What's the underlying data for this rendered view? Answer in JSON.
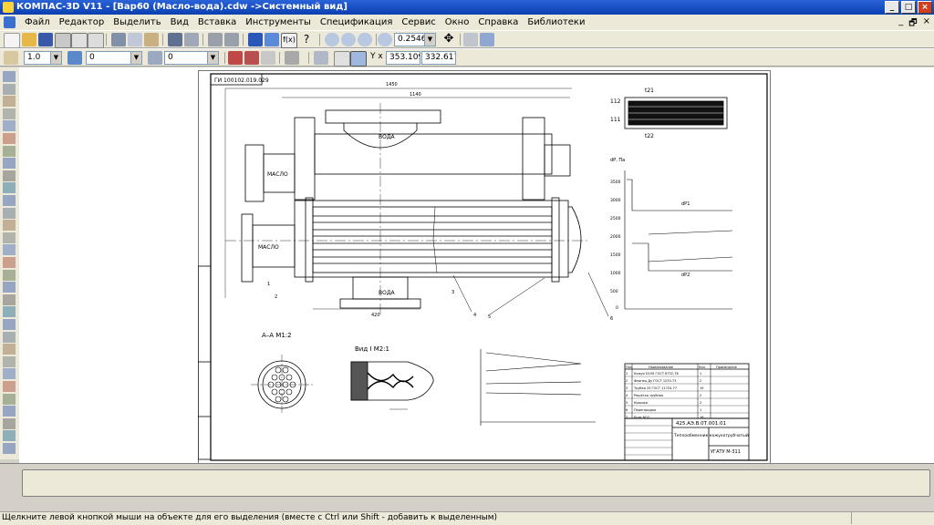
{
  "window": {
    "title": "КОМПАС-3D V11 - [Вар60 (Масло-вода).cdw ->Системный вид]",
    "minimize_glyph": "_",
    "maximize_glyph": "□",
    "close_glyph": "×",
    "doc_min_glyph": "_",
    "doc_restore_glyph": "🗗",
    "doc_close_glyph": "×"
  },
  "menu": [
    "Файл",
    "Редактор",
    "Выделить",
    "Вид",
    "Вставка",
    "Инструменты",
    "Спецификация",
    "Сервис",
    "Окно",
    "Справка",
    "Библиотеки"
  ],
  "toolbar": {
    "zoom_value": "0.2546",
    "step_value": "1.0",
    "layer_value": "0",
    "style_value": "0",
    "coord_x": "353.109",
    "coord_y": "332.617",
    "coord_label": "Y x"
  },
  "drawing": {
    "stamp_top": "ГИ 100102.019.029",
    "section_label": "А–А  М1:2",
    "view_label": "Вид  I   М2:1",
    "label_maslo_in": "МАСЛО",
    "label_maslo_out": "МАСЛО",
    "label_voda_top": "ВОДА",
    "label_voda_bottom": "ВОДА",
    "tube_a": "t21",
    "tube_b": "t22",
    "tube_c": "112",
    "tube_d": "111",
    "graph_y_label": "dP, Па",
    "graph_ticks": [
      "3500",
      "3000",
      "2500",
      "2000",
      "1500",
      "1000",
      "500",
      "0"
    ],
    "graph_dp1": "dP1",
    "graph_dp2": "dP2",
    "doc_number": "425.АЭ.В.0Т.001.01",
    "doc_title": "Теплообменник кожухотрубчатый",
    "org": "УГАТУ М-311",
    "dim_total": "1450",
    "dim_inner": "1140",
    "dim_bottom": "420",
    "callouts": [
      "1",
      "2",
      "3",
      "4",
      "5",
      "6"
    ],
    "spec_header": [
      "Поз.",
      "Наименование",
      "Кол.",
      "Примечание"
    ],
    "spec_rows": [
      [
        "1",
        "Кожух D159 ГОСТ 8732-78",
        "1"
      ],
      [
        "2",
        "Фланец Ду ГОСТ 1233-73",
        "2"
      ],
      [
        "3",
        "Трубка 25 ГОСТ 11724-77",
        "19"
      ],
      [
        "4",
        "Решётка трубная",
        "2"
      ],
      [
        "5",
        "Крышка",
        "2"
      ],
      [
        "6",
        "Перегородка",
        "1"
      ],
      [
        "7",
        "Болт М12",
        "16"
      ]
    ]
  },
  "status": "Щелкните левой кнопкой мыши на объекте для его выделения (вместе с Ctrl или Shift - добавить к выделенным)"
}
